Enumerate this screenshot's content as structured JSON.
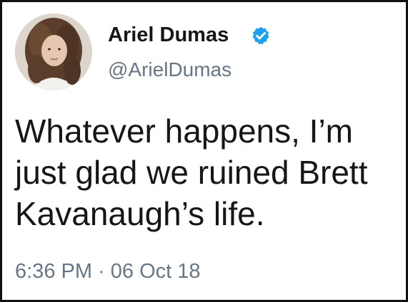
{
  "tweet": {
    "author": {
      "display_name": "Ariel Dumas",
      "handle": "@ArielDumas",
      "verified_icon": "verified-badge-icon"
    },
    "text_lines": [
      "Whatever happens, I’m",
      "just glad we ruined Brett",
      "Kavanaugh’s life."
    ],
    "timestamp": "6:36 PM · 06 Oct 18"
  },
  "colors": {
    "text": "#14171a",
    "secondary_text": "#657786",
    "verified_blue": "#1da1f2",
    "border": "#111111"
  }
}
